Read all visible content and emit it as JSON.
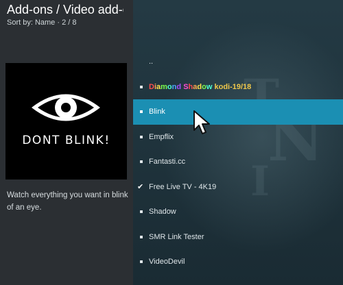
{
  "header": {
    "title": "Add-ons / Video add-ons",
    "sort": "Sort by: Name  ·  2 / 8"
  },
  "addon": {
    "logo_text": "DONT BLINK!",
    "description": "Watch everything you want in blink of an eye."
  },
  "list": {
    "parent": "..",
    "items": [
      {
        "label_part1": "Diamond Shadow",
        "label_part2": "kodi-19/18",
        "state": "bullet"
      },
      {
        "label": "Blink",
        "state": "bullet",
        "selected": true
      },
      {
        "label": "Empflix",
        "state": "bullet"
      },
      {
        "label": "Fantasti.cc",
        "state": "bullet"
      },
      {
        "label": "Free Live TV - 4K19",
        "state": "check"
      },
      {
        "label": "Shadow",
        "state": "bullet"
      },
      {
        "label": "SMR Link Tester",
        "state": "bullet"
      },
      {
        "label": "VideoDevil",
        "state": "bullet"
      }
    ]
  },
  "colors": {
    "selection": "#1b8fb3",
    "panel": "#2b2f33",
    "background": "#1c2a30"
  },
  "icons": {
    "eye": "eye-icon",
    "cursor": "mouse-pointer-icon",
    "check": "checkmark-icon"
  }
}
